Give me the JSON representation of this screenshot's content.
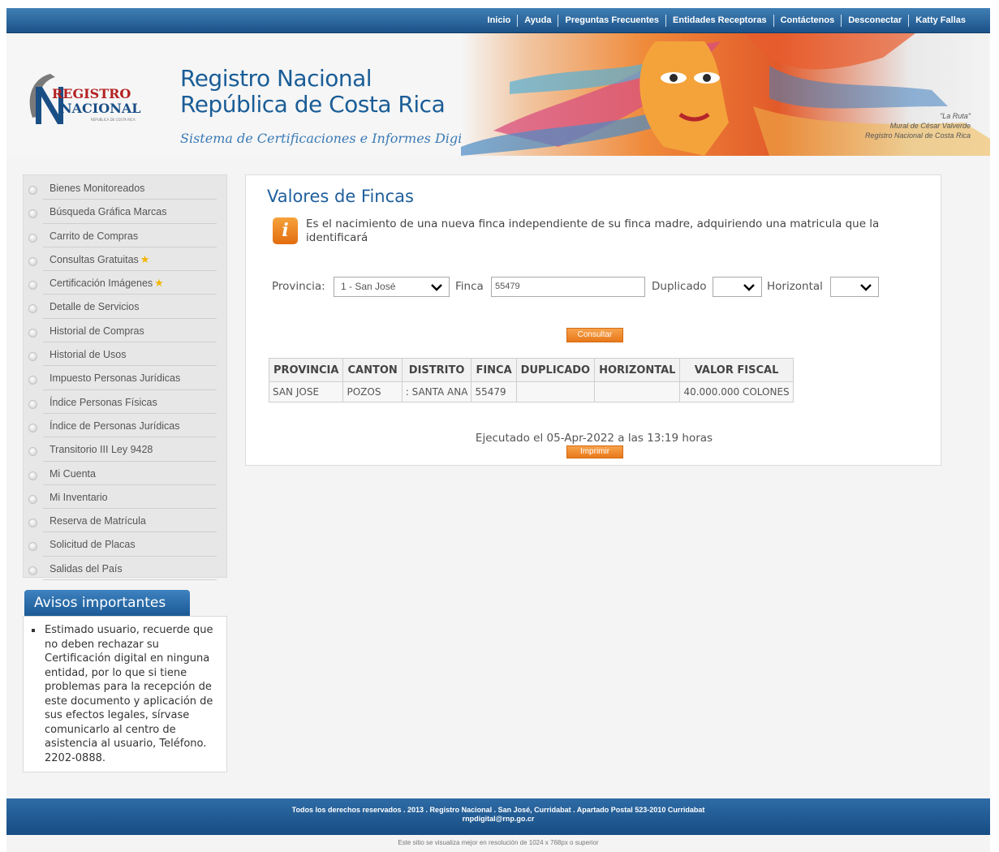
{
  "topnav": {
    "items": [
      "Inicio",
      "Ayuda",
      "Preguntas Frecuentes",
      "Entidades Receptoras",
      "Contáctenos",
      "Desconectar",
      "Katty Fallas"
    ]
  },
  "header": {
    "logo_line1": "REGISTRO",
    "logo_line2": "NACIONAL",
    "logo_small": "REPUBLICA DE COSTA RICA",
    "title_line1": "Registro Nacional",
    "title_line2": "República de Costa Rica",
    "subtitle": "Sistema de Certificaciones e Informes Digitales",
    "mural_caption": [
      "\"La Ruta\"",
      "Mural de César Valverde",
      "Registro Nacional de Costa Rica"
    ]
  },
  "sidebar": {
    "items": [
      {
        "label": "Bienes Monitoreados",
        "star": false
      },
      {
        "label": "Búsqueda Gráfica Marcas",
        "star": false
      },
      {
        "label": "Carrito de Compras",
        "star": false
      },
      {
        "label": "Consultas Gratuitas",
        "star": true
      },
      {
        "label": "Certificación Imágenes",
        "star": true
      },
      {
        "label": "Detalle de Servicios",
        "star": false
      },
      {
        "label": "Historial de Compras",
        "star": false
      },
      {
        "label": "Historial de Usos",
        "star": false
      },
      {
        "label": "Impuesto Personas Jurídicas",
        "star": false
      },
      {
        "label": "Índice Personas Físicas",
        "star": false
      },
      {
        "label": "Índice de Personas Jurídicas",
        "star": false
      },
      {
        "label": "Transitorio III Ley 9428",
        "star": false
      },
      {
        "label": "Mi Cuenta",
        "star": false
      },
      {
        "label": "Mi Inventario",
        "star": false
      },
      {
        "label": "Reserva de Matrícula",
        "star": false
      },
      {
        "label": "Solicitud de Placas",
        "star": false
      },
      {
        "label": "Salidas del País",
        "star": false
      }
    ]
  },
  "avisos": {
    "title": "Avisos importantes",
    "text": "Estimado usuario, recuerde que no deben rechazar su Certificación digital en ninguna entidad, por lo que si tiene problemas para la recepción de este documento y aplicación de sus efectos legales, sírvase comunicarlo al centro de asistencia al usuario, Teléfono. 2202-0888."
  },
  "main": {
    "title": "Valores de Fincas",
    "info_icon_glyph": "i",
    "info_text": "Es el nacimiento de una nueva finca independiente de su finca madre, adquiriendo una matricula que la identificará",
    "form": {
      "provincia_label": "Provincia:",
      "provincia_value": "1 - San José",
      "finca_label": "Finca",
      "finca_value": "55479",
      "duplicado_label": "Duplicado",
      "duplicado_value": "",
      "horizontal_label": "Horizontal",
      "horizontal_value": ""
    },
    "consultar_label": "Consultar",
    "table": {
      "headers": [
        "PROVINCIA",
        "CANTON",
        "DISTRITO",
        "FINCA",
        "DUPLICADO",
        "HORIZONTAL",
        "VALOR FISCAL"
      ],
      "row": [
        "SAN JOSE",
        "POZOS",
        ": SANTA ANA",
        "55479",
        "",
        "",
        "40.000.000 COLONES"
      ]
    },
    "executed": "Ejecutado el 05-Apr-2022 a las 13:19 horas",
    "imprimir_label": "Imprimir"
  },
  "footer": {
    "line1": "Todos los derechos reservados . 2013 . Registro Nacional . San José, Curridabat . Apartado Postal 523-2010 Curridabat",
    "line2": "rnpdigital@rnp.go.cr",
    "note": "Este sitio se visualiza mejor en resolución de 1024 x 768px o superior"
  },
  "colors": {
    "nav_blue": "#1c5288",
    "title_blue": "#1a5d97",
    "orange": "#e8791c",
    "star": "#f2b500"
  }
}
